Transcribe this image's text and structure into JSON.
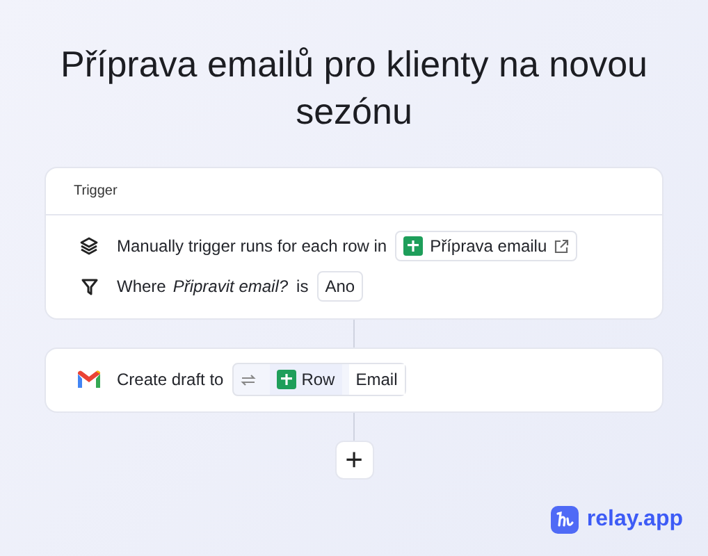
{
  "title": "Příprava emailů pro klienty na novou sezónu",
  "trigger": {
    "header": "Trigger",
    "rows": [
      {
        "kind": "source",
        "text": "Manually trigger runs for each row in",
        "sheet": "Příprava emailu"
      },
      {
        "kind": "filter",
        "text": "Where",
        "field": "Připravit email?",
        "operator": "is",
        "value": "Ano"
      }
    ]
  },
  "action": {
    "text": "Create draft to",
    "source": "Row",
    "field": "Email"
  },
  "add_button": "+",
  "brand": "relay.app"
}
